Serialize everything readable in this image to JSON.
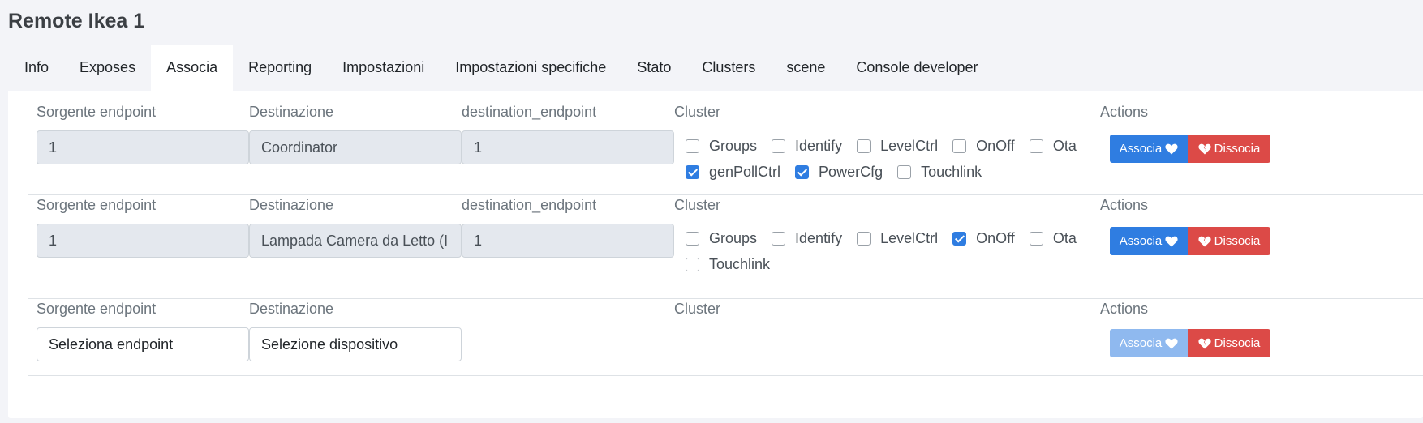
{
  "page": {
    "title": "Remote Ikea 1"
  },
  "tabs": [
    {
      "label": "Info",
      "active": false
    },
    {
      "label": "Exposes",
      "active": false
    },
    {
      "label": "Associa",
      "active": true
    },
    {
      "label": "Reporting",
      "active": false
    },
    {
      "label": "Impostazioni",
      "active": false
    },
    {
      "label": "Impostazioni specifiche",
      "active": false
    },
    {
      "label": "Stato",
      "active": false
    },
    {
      "label": "Clusters",
      "active": false
    },
    {
      "label": "scene",
      "active": false
    },
    {
      "label": "Console developer",
      "active": false
    }
  ],
  "labels": {
    "source": "Sorgente endpoint",
    "destination": "Destinazione",
    "dest_endpoint": "destination_endpoint",
    "cluster": "Cluster",
    "actions": "Actions"
  },
  "buttons": {
    "associa": "Associa",
    "dissocia": "Dissocia"
  },
  "colors": {
    "primary": "#2f7de1",
    "danger": "#dc4a47",
    "disabled_bg": "#e4e8ee"
  },
  "rows": [
    {
      "source_value": "1",
      "destination_value": "Coordinator",
      "dest_endpoint_value": "1",
      "associa_disabled": false,
      "clusters": [
        [
          {
            "name": "Groups",
            "checked": false
          },
          {
            "name": "Identify",
            "checked": false
          },
          {
            "name": "LevelCtrl",
            "checked": false
          },
          {
            "name": "OnOff",
            "checked": false
          },
          {
            "name": "Ota",
            "checked": false
          }
        ],
        [
          {
            "name": "genPollCtrl",
            "checked": true
          },
          {
            "name": "PowerCfg",
            "checked": true
          },
          {
            "name": "Touchlink",
            "checked": false
          }
        ]
      ]
    },
    {
      "source_value": "1",
      "destination_value": "Lampada Camera da Letto (I",
      "dest_endpoint_value": "1",
      "associa_disabled": false,
      "clusters": [
        [
          {
            "name": "Groups",
            "checked": false
          },
          {
            "name": "Identify",
            "checked": false
          },
          {
            "name": "LevelCtrl",
            "checked": false
          },
          {
            "name": "OnOff",
            "checked": true
          },
          {
            "name": "Ota",
            "checked": false
          }
        ],
        [
          {
            "name": "Touchlink",
            "checked": false
          }
        ]
      ]
    },
    {
      "source_value": "Seleziona endpoint",
      "destination_value": "Selezione dispositivo",
      "associa_disabled": true,
      "clusters": []
    }
  ]
}
